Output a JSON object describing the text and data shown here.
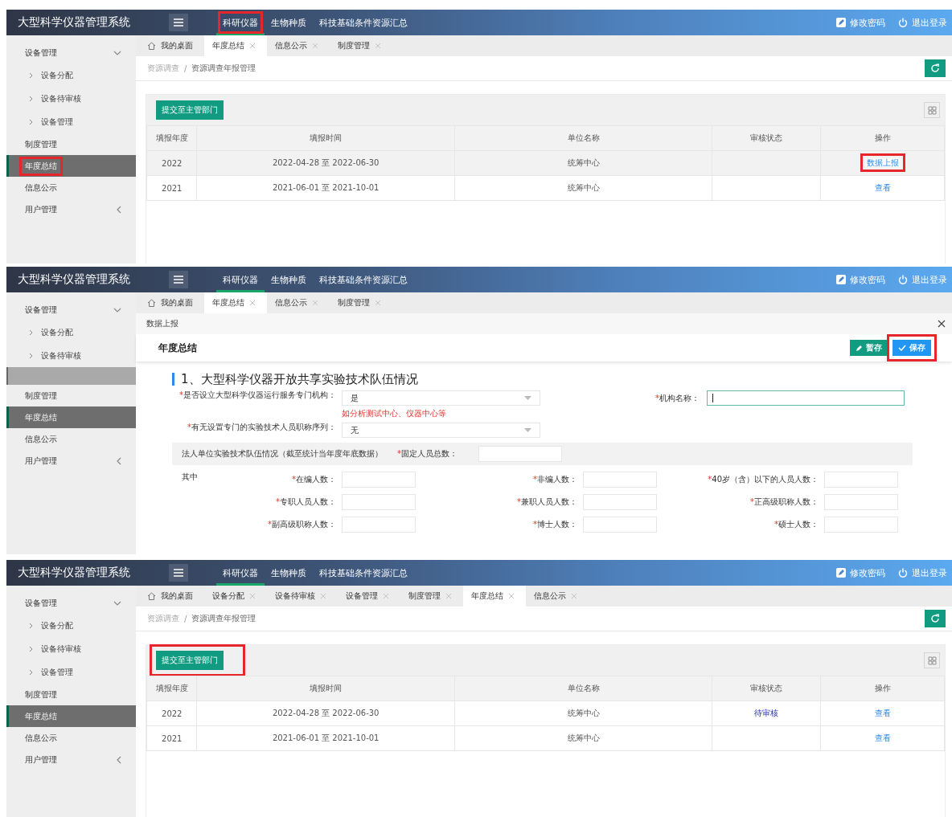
{
  "screens": [
    {
      "header": {
        "title": "大型科学仪器管理系统",
        "nav": [
          {
            "label": "科研仪器",
            "selected": true,
            "highlighted": true
          },
          {
            "label": "生物种质",
            "selected": false,
            "highlighted": false
          },
          {
            "label": "科技基础条件资源汇总",
            "selected": false,
            "highlighted": false
          }
        ],
        "actions": [
          {
            "label": "修改密码",
            "kind": "password"
          },
          {
            "label": "退出登录",
            "kind": "logout"
          }
        ]
      },
      "sidebar": [
        {
          "label": "设备管理",
          "expanded": true,
          "selected": false,
          "highlighted": false,
          "children": [
            {
              "label": "设备分配",
              "selected": false
            },
            {
              "label": "设备待审核",
              "selected": false
            },
            {
              "label": "设备管理",
              "selected": false
            }
          ]
        },
        {
          "label": "制度管理",
          "selected": false,
          "highlighted": false
        },
        {
          "label": "年度总结",
          "selected": true,
          "highlighted": true
        },
        {
          "label": "信息公示",
          "selected": false,
          "highlighted": false
        },
        {
          "label": "用户管理",
          "expanded": false,
          "selected": false,
          "highlighted": false
        }
      ],
      "tabs": [
        {
          "label": "我的桌面",
          "kind": "home",
          "selected": false
        },
        {
          "label": "年度总结",
          "kind": "closable",
          "selected": true
        },
        {
          "label": "信息公示",
          "kind": "closable",
          "selected": false
        },
        {
          "label": "制度管理",
          "kind": "closable",
          "selected": false
        }
      ],
      "content": {
        "kind": "table",
        "breadcrumb": [
          "资源调查",
          "资源调查年报管理"
        ],
        "separator": "/",
        "submit": {
          "label": "提交至主管部门",
          "highlighted": false
        },
        "columns": [
          "填报年度",
          "填报时间",
          "单位名称",
          "审核状态",
          "操作"
        ],
        "rows": [
          {
            "year": "2022",
            "period": "2022-04-28 至 2022-06-30",
            "unit": "统筹中心",
            "hovered": true,
            "action": {
              "label": "数据上报",
              "highlighted": true
            }
          },
          {
            "year": "2021",
            "period": "2021-06-01 至 2021-10-01",
            "unit": "统筹中心",
            "hovered": false,
            "action": {
              "label": "查看",
              "highlighted": false
            }
          }
        ]
      }
    },
    {
      "header": {
        "title": "大型科学仪器管理系统",
        "nav": [
          {
            "label": "科研仪器",
            "selected": true,
            "highlighted": false
          },
          {
            "label": "生物种质",
            "selected": false,
            "highlighted": false
          },
          {
            "label": "科技基础条件资源汇总",
            "selected": false,
            "highlighted": false
          }
        ],
        "actions": [
          {
            "label": "修改密码",
            "kind": "password"
          },
          {
            "label": "退出登录",
            "kind": "logout"
          }
        ]
      },
      "sidebar": [
        {
          "label": "设备管理",
          "expanded": true,
          "selected": false,
          "highlighted": false,
          "children": [
            {
              "label": "设备分配",
              "selected": false
            },
            {
              "label": "设备待审核",
              "selected": false
            },
            {
              "kind": "blank",
              "selected": false
            }
          ]
        },
        {
          "label": "制度管理",
          "selected": false,
          "highlighted": false
        },
        {
          "label": "年度总结",
          "selected": true,
          "highlighted": false
        },
        {
          "label": "信息公示",
          "selected": false,
          "highlighted": false
        },
        {
          "label": "用户管理",
          "expanded": false,
          "selected": false,
          "highlighted": false
        }
      ],
      "tabs": [
        {
          "label": "我的桌面",
          "kind": "home",
          "selected": false
        },
        {
          "label": "年度总结",
          "kind": "closable",
          "selected": true
        },
        {
          "label": "信息公示",
          "kind": "closable",
          "selected": false
        },
        {
          "label": "制度管理",
          "kind": "closable",
          "selected": false
        }
      ],
      "content": {
        "kind": "form",
        "dialog_title": "数据上报",
        "title": "年度总结",
        "buttons": [
          {
            "label": "暂存",
            "kind": "stash",
            "highlighted": false
          },
          {
            "label": "保存",
            "kind": "save",
            "highlighted": true
          }
        ],
        "section": "1、大型科学仪器开放共享实验技术队伍情况",
        "rows": [
          [
            {
              "mark": "*",
              "label": "是否设立大型科学仪器运行服务专门机构：",
              "kind": "select",
              "value": "是",
              "hint": "如分析测试中心、仪器中心等"
            },
            {
              "mark": "*",
              "label": "机构名称：",
              "kind": "text",
              "focused": true
            }
          ],
          [
            {
              "mark": "*",
              "label": "有无设置专门的实验技术人员职称序列：",
              "kind": "select",
              "value": "无"
            }
          ]
        ],
        "group": {
          "text": "法人单位实验技术队伍情况（截至统计当年度年底数据）",
          "mark": "*",
          "label": "固定人员总数："
        },
        "grid": {
          "caption": "其中",
          "fields": [
            {
              "mark": "*",
              "label": "在编人数："
            },
            {
              "mark": "*",
              "label": "非编人数："
            },
            {
              "mark": "*",
              "label": "40岁（含）以下的人员人数："
            },
            {
              "mark": "*",
              "label": "专职人员人数："
            },
            {
              "mark": "*",
              "label": "兼职人员人数："
            },
            {
              "mark": "*",
              "label": "正高级职称人数："
            },
            {
              "mark": "*",
              "label": "副高级职称人数："
            },
            {
              "mark": "*",
              "label": "博士人数："
            },
            {
              "mark": "*",
              "label": "硕士人数："
            }
          ]
        }
      }
    },
    {
      "header": {
        "title": "大型科学仪器管理系统",
        "nav": [
          {
            "label": "科研仪器",
            "selected": true,
            "highlighted": false
          },
          {
            "label": "生物种质",
            "selected": false,
            "highlighted": false
          },
          {
            "label": "科技基础条件资源汇总",
            "selected": false,
            "highlighted": false
          }
        ],
        "actions": [
          {
            "label": "修改密码",
            "kind": "password"
          },
          {
            "label": "退出登录",
            "kind": "logout"
          }
        ]
      },
      "sidebar": [
        {
          "label": "设备管理",
          "expanded": true,
          "selected": false,
          "highlighted": false,
          "children": [
            {
              "label": "设备分配",
              "selected": false
            },
            {
              "label": "设备待审核",
              "selected": false
            },
            {
              "label": "设备管理",
              "selected": false
            }
          ]
        },
        {
          "label": "制度管理",
          "selected": false,
          "highlighted": false
        },
        {
          "label": "年度总结",
          "selected": true,
          "highlighted": false
        },
        {
          "label": "信息公示",
          "selected": false,
          "highlighted": false
        },
        {
          "label": "用户管理",
          "expanded": false,
          "selected": false,
          "highlighted": false
        }
      ],
      "tabs": [
        {
          "label": "我的桌面",
          "kind": "home",
          "selected": false
        },
        {
          "label": "设备分配",
          "kind": "closable",
          "selected": false
        },
        {
          "label": "设备待审核",
          "kind": "closable",
          "selected": false
        },
        {
          "label": "设备管理",
          "kind": "closable",
          "selected": false
        },
        {
          "label": "制度管理",
          "kind": "closable",
          "selected": false
        },
        {
          "label": "年度总结",
          "kind": "closable",
          "selected": true
        },
        {
          "label": "信息公示",
          "kind": "closable",
          "selected": false
        }
      ],
      "content": {
        "kind": "table",
        "breadcrumb": [
          "资源调查",
          "资源调查年报管理"
        ],
        "separator": "/",
        "submit": {
          "label": "提交至主管部门",
          "highlighted": true
        },
        "columns": [
          "填报年度",
          "填报时间",
          "单位名称",
          "审核状态",
          "操作"
        ],
        "rows": [
          {
            "year": "2022",
            "period": "2022-04-28 至 2022-06-30",
            "unit": "统筹中心",
            "status": "待审核",
            "hovered": false,
            "action": {
              "label": "查看",
              "highlighted": false
            }
          },
          {
            "year": "2021",
            "period": "2021-06-01 至 2021-10-01",
            "unit": "统筹中心",
            "hovered": false,
            "action": {
              "label": "查看",
              "highlighted": false
            }
          }
        ]
      }
    }
  ]
}
